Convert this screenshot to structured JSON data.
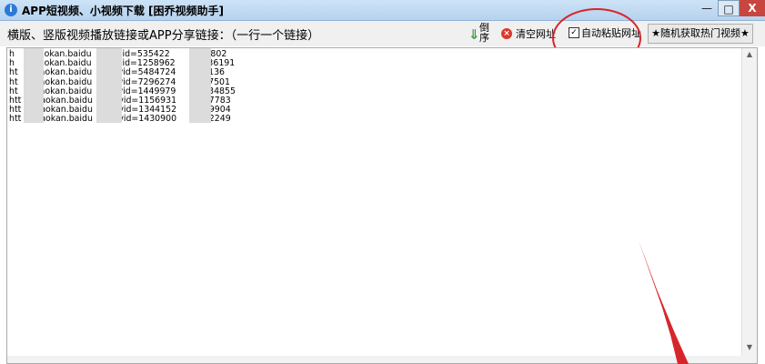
{
  "window": {
    "title": "APP短视频、小视频下载 [困乔视频助手]",
    "icon": "info-icon",
    "min_label": "—",
    "max_label": "□",
    "close_label": "X"
  },
  "toolbar": {
    "instruction": "横版、竖版视频播放链接或APP分享链接：（一行一个链接）",
    "sort_arrow": "⇓",
    "sort_label": "倒序",
    "clear_label": "清空网址",
    "auto_paste_label": "自动粘贴网址",
    "auto_paste_checked": "✓",
    "random_label": "★随机获取热门视频★"
  },
  "links": [
    "h      /haokan.baidu      v?vid=535422       7712802",
    "h      /haokan.baidu      v?vid=1258962      93636191",
    "ht     /haokan.baidu      v?vid=5484724      858136",
    "ht     /haokan.baidu      v?vid=7296274      2507501",
    "ht     /haokan.baidu      v?vid=1449979      94234855",
    "htt    /haokan.baidu      v?vid=1156931      3867783",
    "htt    /haokan.baidu      v?vid=1344152      3659904",
    "htt    /haokan.baidu      v?vid=1430900      7232249"
  ],
  "annotation_color": "#d7262b"
}
